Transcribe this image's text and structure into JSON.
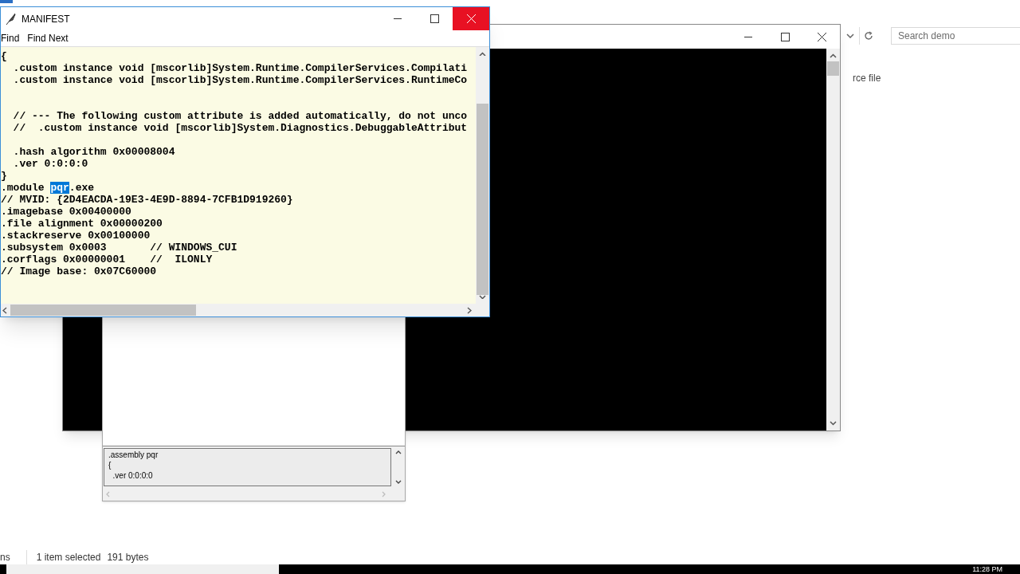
{
  "explorer": {
    "search": {
      "placeholder": "Search demo"
    },
    "column_text": "rce file",
    "status_bar": {
      "left": "ns",
      "selection": "1 item selected",
      "size": "191 bytes"
    }
  },
  "dialog": {
    "text_lines": [
      ".assembly pqr",
      "{",
      "  .ver 0:0:0:0"
    ]
  },
  "manifest": {
    "title": "MANIFEST",
    "menu": [
      "Find",
      "Find Next"
    ],
    "lines": [
      {
        "kind": "text",
        "parts": [
          {
            "text": "{",
            "selected": false
          }
        ]
      },
      {
        "kind": "text",
        "parts": [
          {
            "text": "  .custom instance void [mscorlib]System.Runtime.CompilerServices.Compilati",
            "selected": false
          }
        ]
      },
      {
        "kind": "text",
        "parts": [
          {
            "text": "  .custom instance void [mscorlib]System.Runtime.CompilerServices.RuntimeCo",
            "selected": false
          }
        ]
      },
      {
        "kind": "blank"
      },
      {
        "kind": "blank"
      },
      {
        "kind": "text",
        "parts": [
          {
            "text": "  // --- The following custom attribute is added automatically, do not unco",
            "selected": false
          }
        ]
      },
      {
        "kind": "text",
        "parts": [
          {
            "text": "  //  .custom instance void [mscorlib]System.Diagnostics.DebuggableAttribut",
            "selected": false
          }
        ]
      },
      {
        "kind": "blank"
      },
      {
        "kind": "text",
        "parts": [
          {
            "text": "  .hash algorithm 0x00008004",
            "selected": false
          }
        ]
      },
      {
        "kind": "text",
        "parts": [
          {
            "text": "  .ver 0:0:0:0",
            "selected": false
          }
        ]
      },
      {
        "kind": "text",
        "parts": [
          {
            "text": "}",
            "selected": false
          }
        ]
      },
      {
        "kind": "text",
        "parts": [
          {
            "text": ".module ",
            "selected": false
          },
          {
            "text": "pqr",
            "selected": true
          },
          {
            "text": ".exe",
            "selected": false
          }
        ]
      },
      {
        "kind": "text",
        "parts": [
          {
            "text": "// MVID: {2D4EACDA-19E3-4E9D-8894-7CFB1D919260}",
            "selected": false
          }
        ]
      },
      {
        "kind": "text",
        "parts": [
          {
            "text": ".imagebase 0x00400000",
            "selected": false
          }
        ]
      },
      {
        "kind": "text",
        "parts": [
          {
            "text": ".file alignment 0x00000200",
            "selected": false
          }
        ]
      },
      {
        "kind": "text",
        "parts": [
          {
            "text": ".stackreserve 0x00100000",
            "selected": false
          }
        ]
      },
      {
        "kind": "text",
        "parts": [
          {
            "text": ".subsystem 0x0003       // WINDOWS_CUI",
            "selected": false
          }
        ]
      },
      {
        "kind": "text",
        "parts": [
          {
            "text": ".corflags 0x00000001    //  ILONLY",
            "selected": false
          }
        ]
      },
      {
        "kind": "text",
        "parts": [
          {
            "text": "// Image base: 0x07C60000",
            "selected": false
          }
        ]
      }
    ],
    "close_hovered": true
  },
  "taskbar": {
    "clock": "11:28 PM"
  }
}
